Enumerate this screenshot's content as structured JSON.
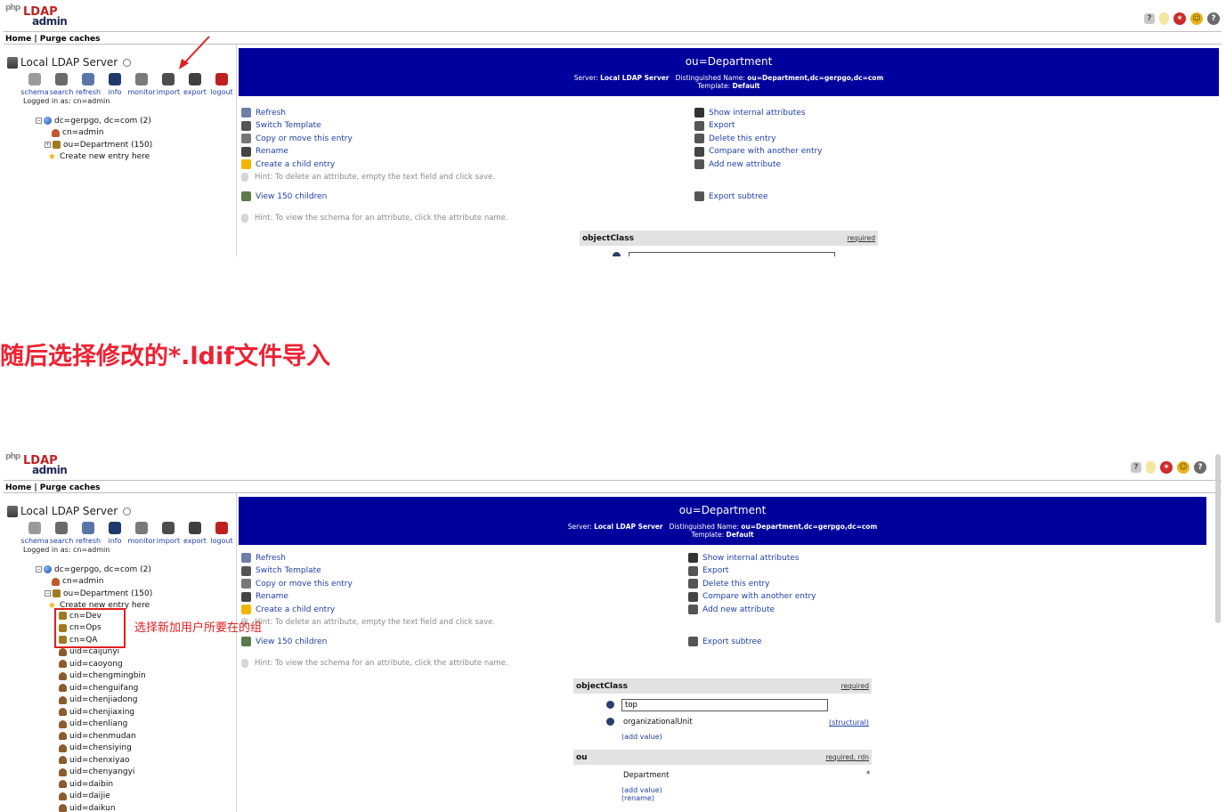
{
  "header": {
    "logo_php": "php",
    "logo_ldap": "LDAP",
    "logo_admin": "admin",
    "icons": [
      "help-icon",
      "hint-bulb-icon",
      "bug-icon",
      "smiley-icon",
      "support-icon"
    ]
  },
  "nav": {
    "home": "Home",
    "sep": "|",
    "purge": "Purge caches"
  },
  "server": {
    "name": "Local LDAP Server"
  },
  "toolbar": [
    {
      "label": "schema",
      "color": "#9a9a9a"
    },
    {
      "label": "search",
      "color": "#6a6a6a"
    },
    {
      "label": "refresh",
      "color": "#5a76a8"
    },
    {
      "label": "info",
      "color": "#1f3a6a"
    },
    {
      "label": "monitor",
      "color": "#7a7a7a"
    },
    {
      "label": "import",
      "color": "#4d4d4d"
    },
    {
      "label": "export",
      "color": "#3f3f3f"
    },
    {
      "label": "logout",
      "color": "#c01f1f"
    }
  ],
  "logged_in": "Logged in as: cn=admin",
  "tree_top": [
    {
      "toggle": "−",
      "icon": "globe",
      "text": "dc=gerpgo, dc=com (2)"
    },
    {
      "toggle": "",
      "icon": "person",
      "text": "cn=admin"
    },
    {
      "toggle": "+",
      "icon": "group",
      "text": "ou=Department (150)"
    },
    {
      "toggle": "",
      "icon": "star",
      "text": "Create new entry here"
    }
  ],
  "tree_bottom": [
    {
      "toggle": "−",
      "icon": "globe",
      "text": "dc=gerpgo, dc=com (2)"
    },
    {
      "toggle": "",
      "icon": "person",
      "text": "cn=admin"
    },
    {
      "toggle": "−",
      "icon": "group",
      "text": "ou=Department (150)"
    },
    {
      "toggle": "",
      "icon": "star",
      "text": "Create new entry here"
    },
    {
      "toggle": "",
      "icon": "group",
      "text": "cn=Dev"
    },
    {
      "toggle": "",
      "icon": "group",
      "text": "cn=Ops"
    },
    {
      "toggle": "",
      "icon": "group",
      "text": "cn=QA"
    },
    {
      "toggle": "",
      "icon": "user",
      "text": "uid=caijunyi"
    },
    {
      "toggle": "",
      "icon": "user",
      "text": "uid=caoyong"
    },
    {
      "toggle": "",
      "icon": "user",
      "text": "uid=chengmingbin"
    },
    {
      "toggle": "",
      "icon": "user",
      "text": "uid=chenguifang"
    },
    {
      "toggle": "",
      "icon": "user",
      "text": "uid=chenjiadong"
    },
    {
      "toggle": "",
      "icon": "user",
      "text": "uid=chenjiaxing"
    },
    {
      "toggle": "",
      "icon": "user",
      "text": "uid=chenliang"
    },
    {
      "toggle": "",
      "icon": "user",
      "text": "uid=chenmudan"
    },
    {
      "toggle": "",
      "icon": "user",
      "text": "uid=chensiying"
    },
    {
      "toggle": "",
      "icon": "user",
      "text": "uid=chenxiyao"
    },
    {
      "toggle": "",
      "icon": "user",
      "text": "uid=chenyangyi"
    },
    {
      "toggle": "",
      "icon": "user",
      "text": "uid=daibin"
    },
    {
      "toggle": "",
      "icon": "user",
      "text": "uid=daijie"
    },
    {
      "toggle": "",
      "icon": "user",
      "text": "uid=daikun"
    }
  ],
  "banner": {
    "title": "ou=Department",
    "server_label": "Server:",
    "server_value": "Local LDAP Server",
    "dn_label": "Distinguished Name:",
    "dn_value": "ou=Department,dc=gerpgo,dc=com",
    "template_label": "Template:",
    "template_value": "Default"
  },
  "actions_left": [
    {
      "label": "Refresh",
      "color": "#6d7ea8"
    },
    {
      "label": "Switch Template",
      "color": "#555"
    },
    {
      "label": "Copy or move this entry",
      "color": "#777"
    },
    {
      "label": "Rename",
      "color": "#444"
    },
    {
      "label": "Create a child entry",
      "color": "#f2b600"
    }
  ],
  "hint1": "Hint: To delete an attribute, empty the text field and click save.",
  "view_children": "View 150 children",
  "hint2": "Hint: To view the schema for an attribute, click the attribute name.",
  "actions_right": [
    {
      "label": "Show internal attributes",
      "color": "#333"
    },
    {
      "label": "Export",
      "color": "#555"
    },
    {
      "label": "Delete this entry",
      "color": "#555"
    },
    {
      "label": "Compare with another entry",
      "color": "#444"
    },
    {
      "label": "Add new attribute",
      "color": "#555"
    }
  ],
  "export_subtree": "Export subtree",
  "attr_objectclass": {
    "name": "objectClass",
    "flag": "required"
  },
  "oc_value1": "top",
  "oc_value2": "organizationalUnit",
  "oc_value2_flag": "(structural)",
  "add_value": "(add value)",
  "attr_ou": {
    "name": "ou",
    "flag": "required, rdn"
  },
  "ou_value": "Department",
  "ou_star": "*",
  "rename": "(rename)",
  "caption": "随后选择修改的*.ldif文件导入",
  "annotation": "选择新加用户所要在的组",
  "colors": {
    "banner": "#00009c",
    "link": "#1f3fa8",
    "annotation": "#e02020"
  }
}
